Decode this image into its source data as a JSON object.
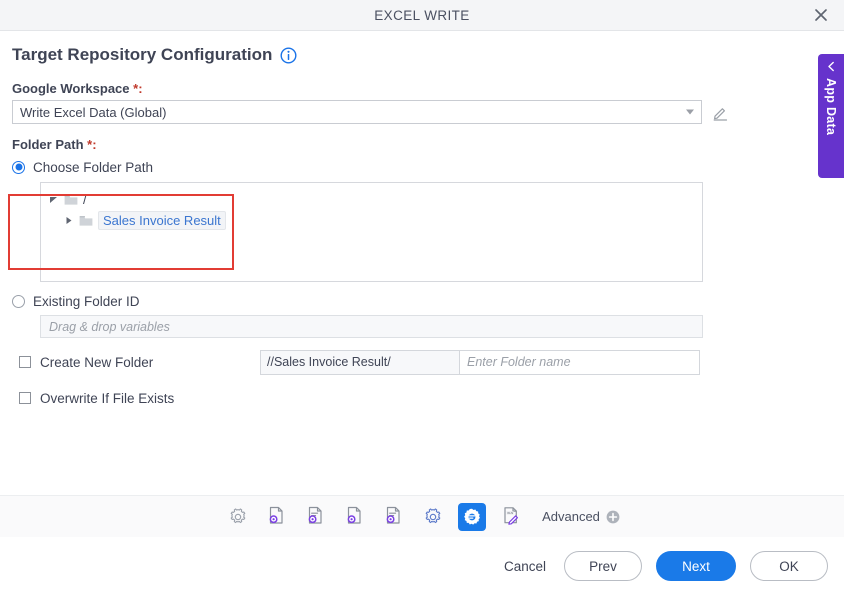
{
  "window": {
    "title": "EXCEL WRITE",
    "close_icon": "close-icon"
  },
  "page": {
    "title": "Target Repository Configuration",
    "info_icon": "info-icon"
  },
  "workspace": {
    "label": "Google Workspace",
    "required_mark": "*:",
    "selected_value": "Write Excel Data (Global)",
    "edit_icon": "pencil-edit-icon",
    "caret_icon": "chevron-down-icon"
  },
  "folder_path": {
    "label": "Folder Path",
    "required_mark": "*:",
    "choose_option": {
      "label": "Choose Folder Path",
      "selected": true
    },
    "tree": [
      {
        "label": "/",
        "expanded": true,
        "arrow_icon": "triangle-down-icon",
        "folder_icon": "folder-icon",
        "is_link": false,
        "selected": false
      },
      {
        "label": "Sales Invoice Result",
        "expanded": false,
        "arrow_icon": "triangle-right-icon",
        "folder_icon": "folder-icon",
        "is_link": true,
        "selected": true
      }
    ],
    "existing_option": {
      "label": "Existing Folder ID",
      "selected": false,
      "placeholder": "Drag & drop variables"
    }
  },
  "create_new_folder": {
    "label": "Create New Folder",
    "checked": false,
    "path_prefix": "//Sales Invoice Result/",
    "name_placeholder": "Enter Folder name"
  },
  "overwrite": {
    "label": "Overwrite If File Exists",
    "checked": false
  },
  "app_data_tab": {
    "label": "App Data",
    "chevron_icon": "chevron-left-icon"
  },
  "toolbar": {
    "items": [
      {
        "name": "settings-gear-icon",
        "active": false
      },
      {
        "name": "document-gear-icon",
        "active": false
      },
      {
        "name": "document-lines-gear-icon",
        "active": false
      },
      {
        "name": "document-gear-icon-2",
        "active": false
      },
      {
        "name": "document-lines-gear-icon-2",
        "active": false
      },
      {
        "name": "settings-gear-icon-2",
        "active": false
      },
      {
        "name": "configuration-gear-icon",
        "active": true
      },
      {
        "name": "xls-edit-icon",
        "active": false
      }
    ],
    "advanced_label": "Advanced",
    "advanced_icon": "plus-circle-icon"
  },
  "actions": {
    "cancel": "Cancel",
    "prev": "Prev",
    "next": "Next",
    "ok": "OK"
  },
  "colors": {
    "accent_blue": "#1a7ae8",
    "link_blue": "#3b76d0",
    "purple": "#6633cc",
    "icon_purple": "#7b3fe4",
    "highlight_red": "#e23c34",
    "required_red": "#c0392b"
  }
}
